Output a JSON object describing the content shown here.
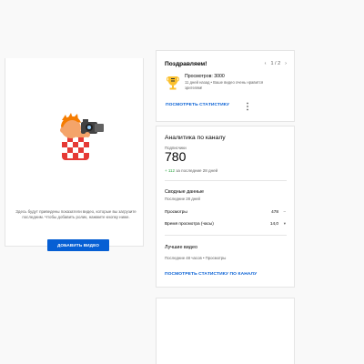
{
  "left_panel": {
    "empty_text": "Здесь будут приведены показатели видео, которые вы загрузите последним. Чтобы добавить ролик, нажмите кнопку ниже.",
    "upload_button": "ДОБАВИТЬ ВИДЕО"
  },
  "congrats": {
    "title": "Поздравляем!",
    "pager": {
      "prev": "‹",
      "position": "1 / 2",
      "next": "›"
    },
    "milestone_title": "Просмотров: 3000",
    "milestone_desc": "11 дней назад • Ваше видео очень нравится зрителям!",
    "link": "ПОСМОТРЕТЬ СТАТИСТИКУ"
  },
  "analytics": {
    "title": "Аналитика по каналу",
    "subscribers_label": "Подписчики",
    "subscribers_value": "780",
    "delta_value": "+ 112",
    "delta_period": "за последние 28 дней",
    "summary_title": "Сводные данные",
    "summary_period": "Последние 28 дней",
    "rows": [
      {
        "label": "Просмотры",
        "value": "478",
        "trend": "–"
      },
      {
        "label": "Время просмотра (часы)",
        "value": "14,0",
        "trend": "▾"
      }
    ],
    "top_videos_title": "Лучшие видео",
    "top_videos_sub": "Последние 48 часов • Просмотры",
    "link": "ПОСМОТРЕТЬ СТАТИСТИКУ ПО КАНАЛУ"
  },
  "colors": {
    "accent": "#065fd4",
    "positive": "#2ba640",
    "muted_text": "#606060",
    "background": "#f9f9f9"
  },
  "icons": {
    "illustration": "photographer-illustration",
    "trophy": "trophy-icon",
    "more": "more-vert-icon"
  }
}
